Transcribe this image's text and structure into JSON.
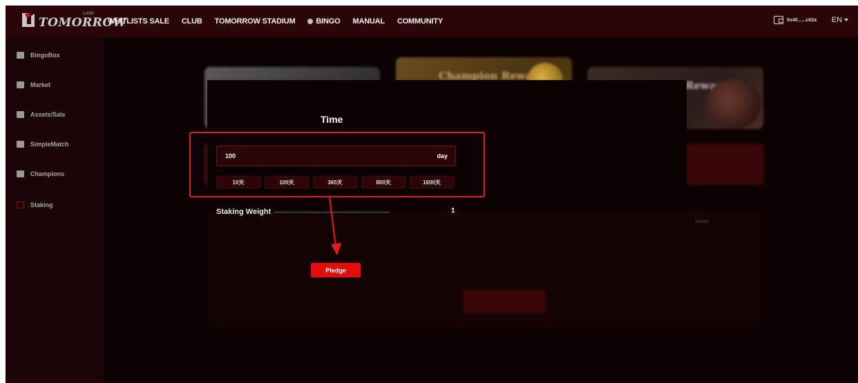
{
  "header": {
    "logo_text": "TOMORROW",
    "logo_sup": "LAND",
    "nav": [
      {
        "label": "WHITLISTS SALE"
      },
      {
        "label": "CLUB"
      },
      {
        "label": "TOMORROW STADIUM"
      },
      {
        "label": "BINGO"
      },
      {
        "label": "MANUAL"
      },
      {
        "label": "COMMUNITY"
      }
    ],
    "wallet_address": "0x40......c62a",
    "language": "EN"
  },
  "sidebar": {
    "items": [
      {
        "label": "BingoBox",
        "icon": "box-icon"
      },
      {
        "label": "Market",
        "icon": "grid-icon"
      },
      {
        "label": "Assets/Sale",
        "icon": "cart-icon"
      },
      {
        "label": "SimpleMatch",
        "icon": "match-icon"
      },
      {
        "label": "Champions",
        "icon": "trophy-icon"
      },
      {
        "label": "Staking",
        "icon": "staking-icon",
        "active": true
      }
    ]
  },
  "background": {
    "card2_title": "Champion Reward",
    "card3_title": "Reward",
    "table_status_header": "Status"
  },
  "modal": {
    "title": "Time",
    "time_input_value": "100",
    "time_unit": "day",
    "presets": [
      "10天",
      "100天",
      "365天",
      "800天",
      "1600天"
    ],
    "staking_weight_label": "Staking Weight",
    "staking_weight_value": "1",
    "pledge_label": "Pledge"
  },
  "colors": {
    "accent": "#e30d0d",
    "highlight_border": "#e51c1c",
    "topbar": "#2a0608",
    "sidebar": "#1c0506"
  }
}
